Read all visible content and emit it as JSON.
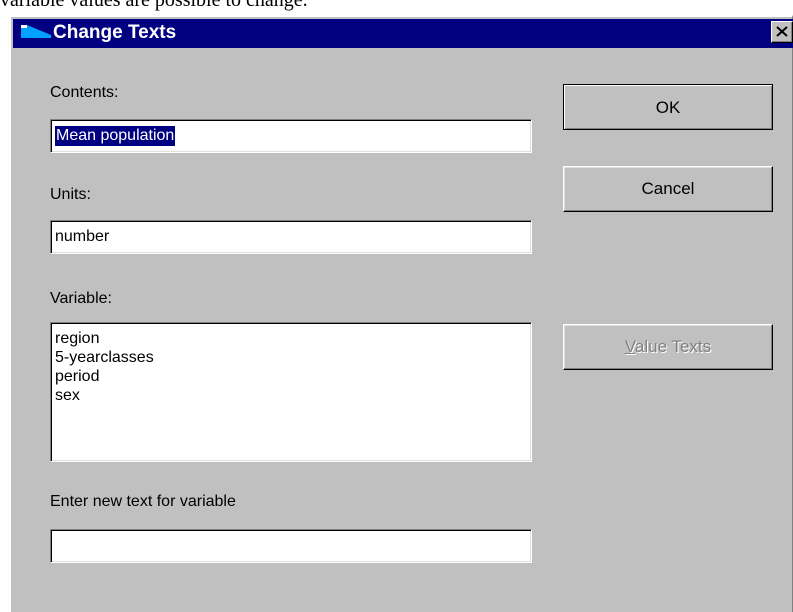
{
  "document": {
    "fragment_text": "variable values are possible to change."
  },
  "dialog": {
    "title": "Change Texts",
    "title_icon": "arrow-flag-icon",
    "close_icon": "close-icon",
    "contents": {
      "label": "Contents:",
      "value": "Mean population"
    },
    "units": {
      "label": "Units:",
      "value": "number"
    },
    "variable": {
      "label": "Variable:",
      "items": [
        "region",
        "5-yearclasses",
        "period",
        "sex"
      ]
    },
    "new_text": {
      "label": "Enter new text for variable",
      "value": ""
    },
    "buttons": {
      "ok": "OK",
      "cancel": "Cancel",
      "value_texts_mnemonic": "V",
      "value_texts_rest": "alue Texts"
    },
    "colors": {
      "titlebar": "#000080",
      "face": "#c0c0c0",
      "selection": "#000080",
      "disabled_text": "#808080"
    }
  }
}
